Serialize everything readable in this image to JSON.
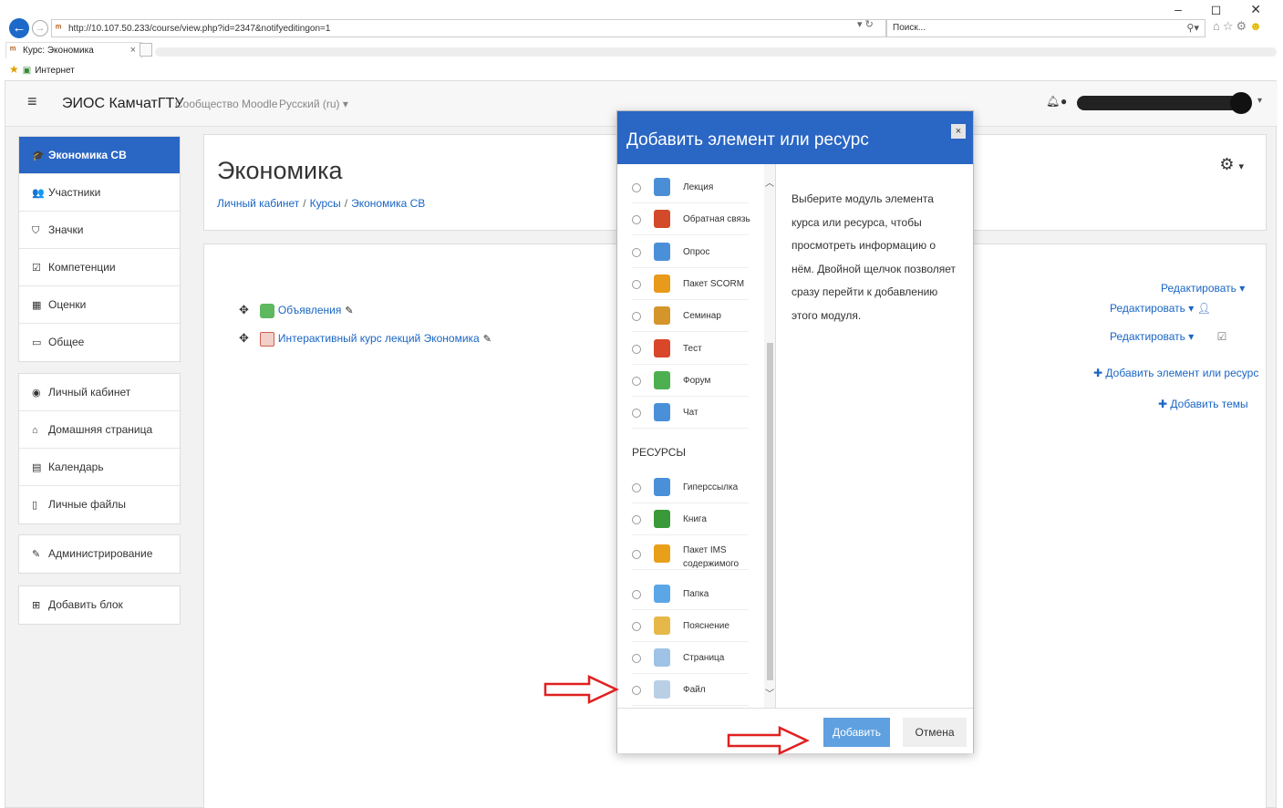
{
  "browser": {
    "url": "http://10.107.50.233/course/view.php?id=2347&notifyeditingon=1",
    "url_tools": "▾ ↻",
    "search_placeholder": "Поиск...",
    "tab_title": "Курс: Экономика",
    "tab_close": "×",
    "favorites_label": "Интернет",
    "window_controls": "–  ◻  ✕"
  },
  "navbar": {
    "brand": "ЭИОС КамчатГТУ",
    "community": "Сообщество Moodle",
    "language": "Русский (ru) ▾"
  },
  "sidebar": {
    "course": [
      {
        "label": "Экономика СВ",
        "icon": "graduation-cap-icon",
        "glyph": "🎓"
      },
      {
        "label": "Участники",
        "icon": "users-icon",
        "glyph": "👥"
      },
      {
        "label": "Значки",
        "icon": "shield-icon",
        "glyph": "⛉"
      },
      {
        "label": "Компетенции",
        "icon": "check-square-icon",
        "glyph": "☑"
      },
      {
        "label": "Оценки",
        "icon": "table-icon",
        "glyph": "▦"
      },
      {
        "label": "Общее",
        "icon": "folder-icon",
        "glyph": "▭"
      }
    ],
    "site": [
      {
        "label": "Личный кабинет",
        "icon": "dashboard-icon",
        "glyph": "◉"
      },
      {
        "label": "Домашняя страница",
        "icon": "home-icon",
        "glyph": "⌂"
      },
      {
        "label": "Календарь",
        "icon": "calendar-icon",
        "glyph": "▤"
      },
      {
        "label": "Личные файлы",
        "icon": "file-icon",
        "glyph": "▯"
      }
    ],
    "admin": [
      {
        "label": "Администрирование",
        "icon": "wrench-icon",
        "glyph": "✎"
      }
    ],
    "block": [
      {
        "label": "Добавить блок",
        "icon": "plus-square-icon",
        "glyph": "⊞"
      }
    ]
  },
  "course": {
    "title": "Экономика",
    "breadcrumb": [
      "Личный кабинет",
      "Курсы",
      "Экономика СВ"
    ],
    "activities": [
      {
        "label": "Объявления",
        "icon": "forum-icon"
      },
      {
        "label": "Интерактивный курс лекций Экономика",
        "icon": "pdf-file-icon"
      }
    ],
    "edit_label": "Редактировать ▾",
    "add_activity": "Добавить элемент или ресурс",
    "add_topics": "Добавить темы"
  },
  "modal": {
    "title": "Добавить элемент или ресурс",
    "close": "×",
    "activities": [
      {
        "label": "Лекция",
        "icon": "lesson-icon",
        "color": "#4a8fd6"
      },
      {
        "label": "Обратная связь",
        "icon": "megaphone-icon",
        "color": "#d24a2a"
      },
      {
        "label": "Опрос",
        "icon": "question-icon",
        "color": "#4a90d9"
      },
      {
        "label": "Пакет SCORM",
        "icon": "scorm-package-icon",
        "color": "#e89a1a"
      },
      {
        "label": "Семинар",
        "icon": "workshop-icon",
        "color": "#d4952a"
      },
      {
        "label": "Тест",
        "icon": "quiz-check-icon",
        "color": "#d9462a"
      },
      {
        "label": "Форум",
        "icon": "forum-icon",
        "color": "#4caf50"
      },
      {
        "label": "Чат",
        "icon": "chat-icon",
        "color": "#4a90d9"
      }
    ],
    "resources_header": "РЕСУРСЫ",
    "resources": [
      {
        "label": "Гиперссылка",
        "icon": "url-link-icon",
        "color": "#4a90d9"
      },
      {
        "label": "Книга",
        "icon": "book-icon",
        "color": "#3a9a3a"
      },
      {
        "label": "Пакет IMS содержимого",
        "icon": "ims-package-icon",
        "color": "#e8a01a"
      },
      {
        "label": "Папка",
        "icon": "folder-icon",
        "color": "#5aa6e6"
      },
      {
        "label": "Пояснение",
        "icon": "label-tag-icon",
        "color": "#e6b84a"
      },
      {
        "label": "Страница",
        "icon": "page-icon",
        "color": "#9fc3e6"
      },
      {
        "label": "Файл",
        "icon": "file-icon",
        "color": "#b8cfe6"
      }
    ],
    "description": "Выберите модуль элемента курса или ресурса, чтобы просмотреть информацию о нём. Двойной щелчок позволяет сразу перейти к добавлению этого модуля.",
    "add_button": "Добавить",
    "cancel_button": "Отмена"
  },
  "colors": {
    "accent": "#2a66c4",
    "link": "#1a66c4",
    "add_button": "#5fa0e0",
    "annotation_arrow": "#e02020"
  }
}
